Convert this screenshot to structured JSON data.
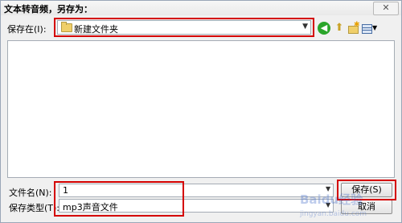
{
  "window": {
    "title": "文本转音频，另存为：",
    "close_label": "✕"
  },
  "save_in": {
    "label": "保存在(I):",
    "value": "新建文件夹"
  },
  "toolbar": {
    "back_icon": "back-icon",
    "up_icon": "up-folder-icon",
    "new_folder_icon": "new-folder-icon",
    "view_icon": "view-menu-icon"
  },
  "filename": {
    "label": "文件名(N):",
    "value": "1"
  },
  "filetype": {
    "label": "保存类型(T):",
    "value": "mp3声音文件"
  },
  "buttons": {
    "save": "保存(S)",
    "cancel": "取消"
  },
  "watermark": {
    "text": "Baidu经验",
    "sub": "jingyan.baidu.com"
  },
  "colors": {
    "highlight": "#d40000",
    "dialog_bg": "#f0f0f0"
  }
}
